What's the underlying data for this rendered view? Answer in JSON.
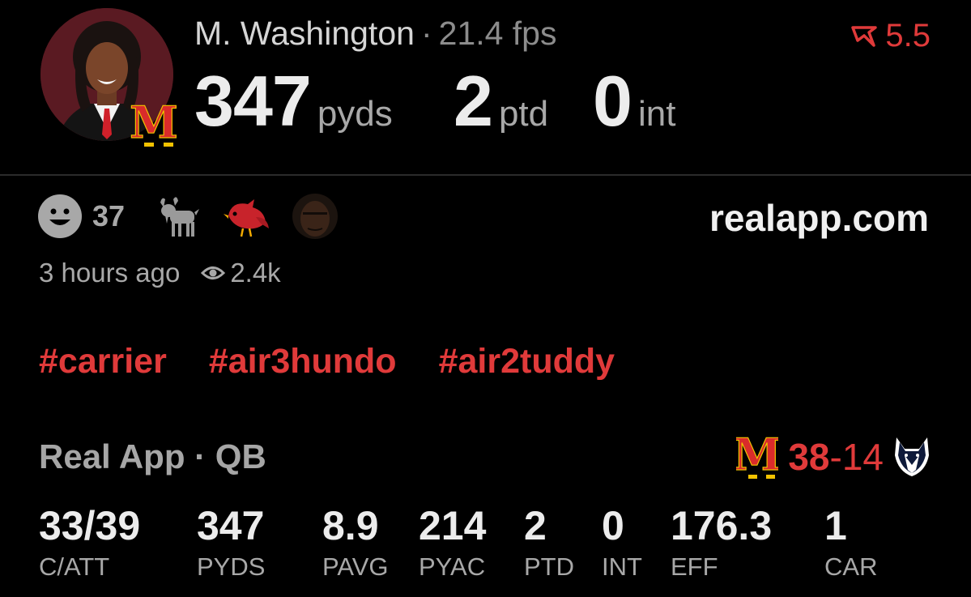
{
  "header": {
    "player_name": "M. Washington",
    "separator": "·",
    "fps": "21.4 fps",
    "rating": "5.5",
    "big_stats": [
      {
        "value": "347",
        "unit": "pyds"
      },
      {
        "value": "2",
        "unit": "ptd"
      },
      {
        "value": "0",
        "unit": "int"
      }
    ]
  },
  "reactions": {
    "count": "37",
    "emojis": [
      "goat-emoji",
      "cardinal-emoji",
      "face-emoji"
    ]
  },
  "site": "realapp.com",
  "meta": {
    "time_ago": "3 hours ago",
    "views": "2.4k"
  },
  "tags": [
    "#carrier",
    "#air3hundo",
    "#air2tuddy"
  ],
  "game": {
    "source": "Real App · QB",
    "team_score": "38",
    "dash": "-",
    "opp_score": "14"
  },
  "stats": [
    {
      "value": "33/39",
      "label": "C/ATT"
    },
    {
      "value": "347",
      "label": "PYDS"
    },
    {
      "value": "8.9",
      "label": "PAVG"
    },
    {
      "value": "214",
      "label": "PYAC"
    },
    {
      "value": "2",
      "label": "PTD"
    },
    {
      "value": "0",
      "label": "INT"
    },
    {
      "value": "176.3",
      "label": "EFF"
    },
    {
      "value": "1",
      "label": "CAR"
    }
  ],
  "colors": {
    "accent_red": "#e03a3a",
    "background": "#000000",
    "muted": "#a8a8a8"
  }
}
